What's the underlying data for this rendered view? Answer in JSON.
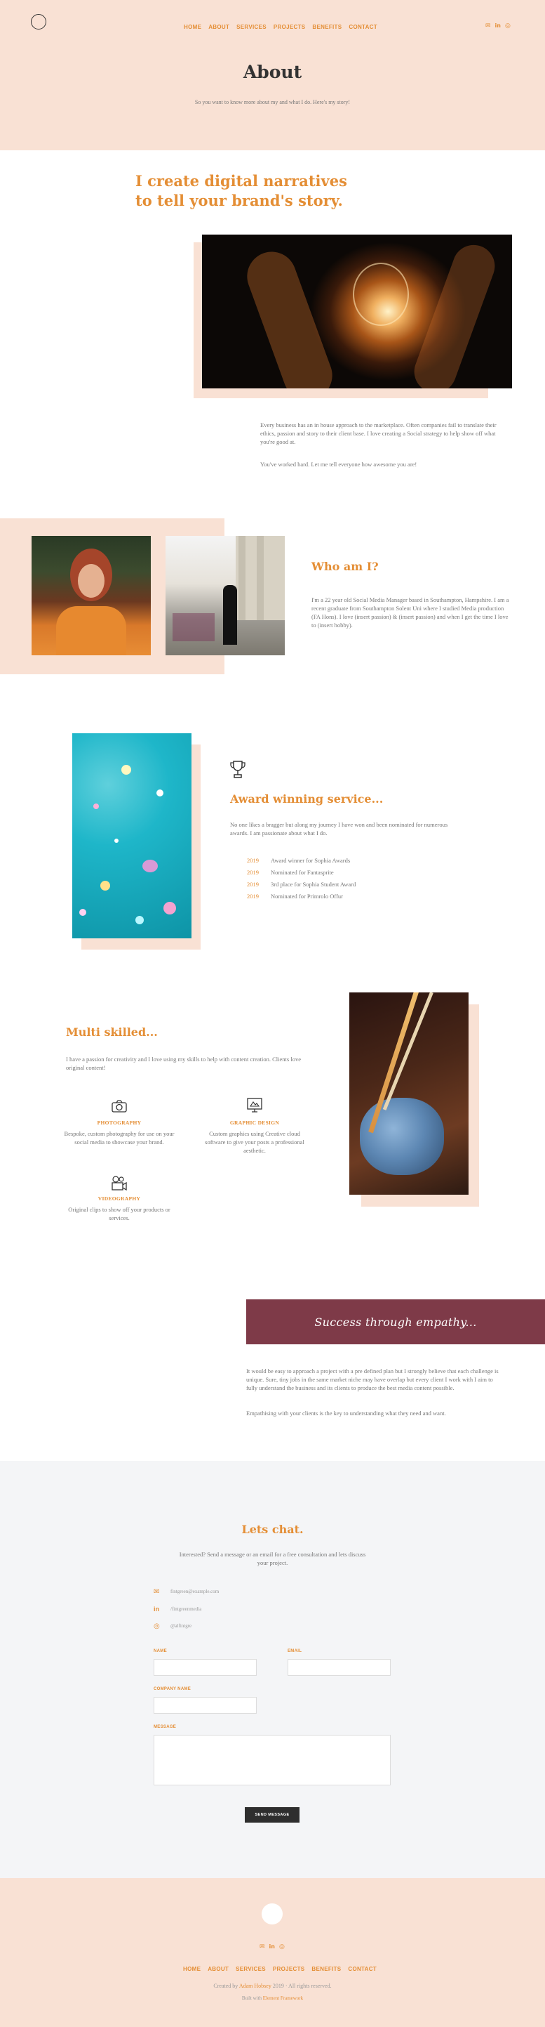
{
  "nav": {
    "links": [
      "HOME",
      "ABOUT",
      "SERVICES",
      "PROJECTS",
      "BENEFITS",
      "CONTACT"
    ],
    "social_icons": [
      "envelope-icon",
      "linkedin-icon",
      "instagram-icon"
    ]
  },
  "hero": {
    "title": "About",
    "subtitle": "So you want to know more about my and what I do. Here's my story!"
  },
  "intro": {
    "heading": "I create digital narratives to tell your brand's story.",
    "p1": "Every business has an in house approach to the marketplace. Often companies fail to translate their ethics, passion and story to their client base. I love creating a Social strategy to help show off what you're good at.",
    "p2": "You've worked hard. Let me tell everyone how awesome you are!"
  },
  "who": {
    "heading": "Who am I?",
    "text": "I'm a 22 year old Social Media Manager based in Southampton, Hampshire. I am a recent graduate from Southampton Solent Uni where I studied Media production (FA Hons). I love (insert passion) & (insert passion) and when I get the time I love to (insert hobby)."
  },
  "awards": {
    "heading": "Award winning service...",
    "text": "No one likes a bragger but along my journey I have won and been nominated for numerous awards. I am passionate about what I do.",
    "items": [
      {
        "year": "2019",
        "text": "Award winner for Sophia Awards"
      },
      {
        "year": "2019",
        "text": "Nominated for Fantasprite"
      },
      {
        "year": "2019",
        "text": "3rd place for Sophia Student Award"
      },
      {
        "year": "2019",
        "text": "Nominated for Primrolo Offur"
      }
    ]
  },
  "skills": {
    "heading": "Multi skilled...",
    "text": "I have a passion for creativity and I love using my skills to help with content creation. Clients love original content!",
    "items": [
      {
        "title": "PHOTOGRAPHY",
        "text": "Bespoke, custom photography for use on your social media to showcase your brand.",
        "icon": "camera-icon"
      },
      {
        "title": "GRAPHIC DESIGN",
        "text": "Custom graphics using Creative cloud software to give your posts a professional aesthetic.",
        "icon": "design-icon"
      },
      {
        "title": "VIDEOGRAPHY",
        "text": "Original clips to show off your products or services.",
        "icon": "video-camera-icon"
      }
    ]
  },
  "empathy": {
    "banner": "Success through empathy...",
    "p1": "It would be easy to approach a project with a pre defined plan but I strongly believe that each challenge is unique. Sure, tiny jobs in the same market niche may have overlap but every client I work with I aim to fully understand the business and its clients to produce the best media content possible.",
    "p2": "Empathising with your clients is the key to understanding what they need and want."
  },
  "contact": {
    "heading": "Lets chat.",
    "text": "Interested? Send a message or an email for a free consultation and lets discuss your project.",
    "email": "fintgreen@example.com",
    "linkedin": "/fintgreenmedia",
    "instagram": "@alfintgre",
    "labels": {
      "name": "NAME",
      "email": "EMAIL",
      "company": "COMPANY NAME",
      "message": "MESSAGE"
    },
    "button": "SEND MESSAGE"
  },
  "footer": {
    "links": [
      "HOME",
      "ABOUT",
      "SERVICES",
      "PROJECTS",
      "BENEFITS",
      "CONTACT"
    ],
    "credit_prefix": "Created by",
    "credit_name": "Adam Hobsey",
    "credit_suffix": "2019 · All rights reserved.",
    "built_prefix": "Built with",
    "built_name": "Element Framework"
  },
  "colors": {
    "accent": "#e48e35",
    "peach": "#f9e1d4",
    "banner": "#7e3a48",
    "grey_bg": "#f4f5f7"
  }
}
